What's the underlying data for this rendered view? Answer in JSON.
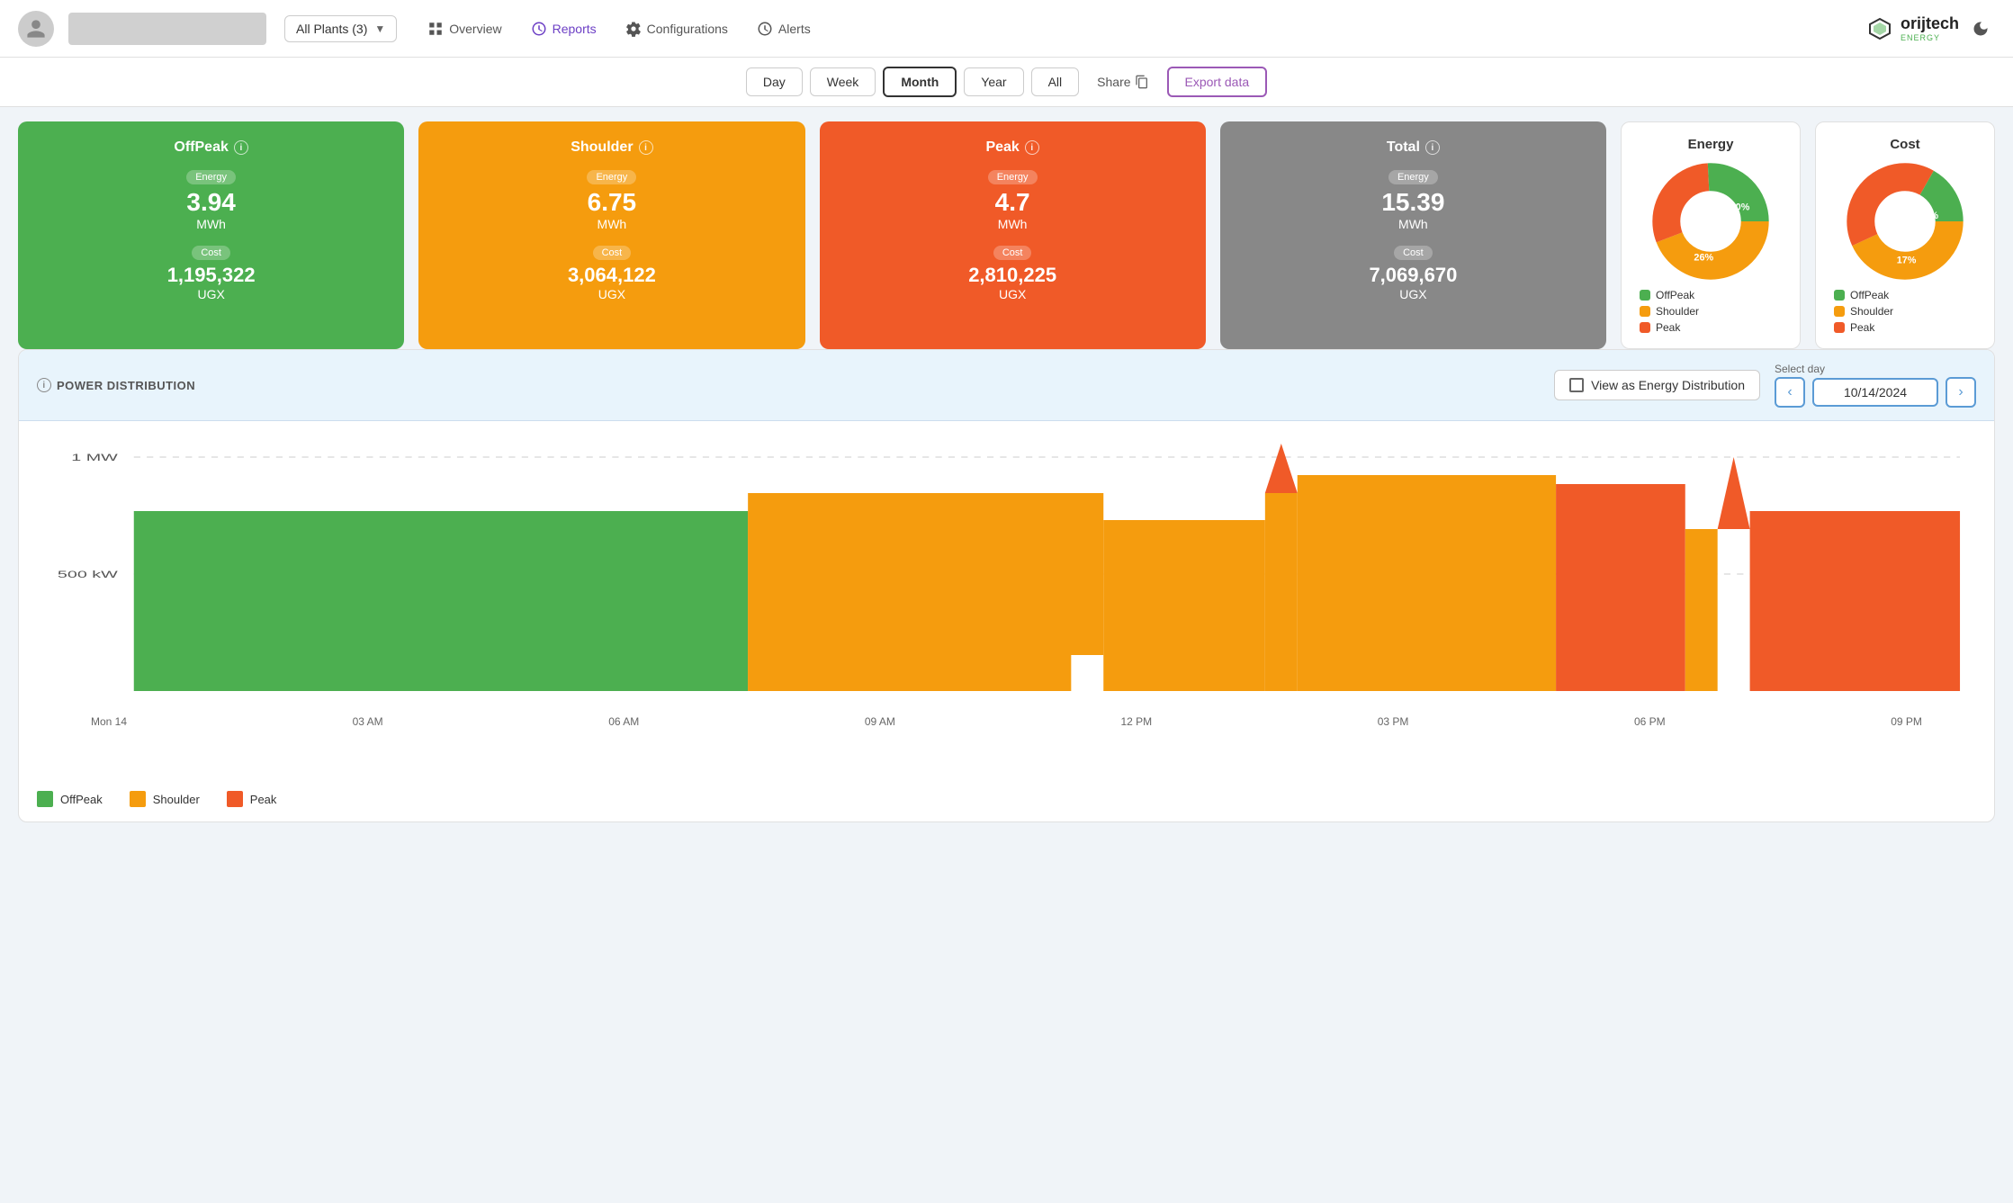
{
  "header": {
    "plant_selector": "All Plants (3)",
    "nav_items": [
      {
        "id": "overview",
        "label": "Overview",
        "icon": "grid"
      },
      {
        "id": "reports",
        "label": "Reports",
        "icon": "gear",
        "active": true
      },
      {
        "id": "configurations",
        "label": "Configurations",
        "icon": "gear"
      },
      {
        "id": "alerts",
        "label": "Alerts",
        "icon": "gear"
      }
    ],
    "brand_name": "orijtech",
    "brand_sub": "ENERGY"
  },
  "toolbar": {
    "periods": [
      "Day",
      "Week",
      "Month",
      "Year",
      "All"
    ],
    "active_period": "Month",
    "share_label": "Share",
    "export_label": "Export data"
  },
  "cards": {
    "offpeak": {
      "title": "OffPeak",
      "energy_label": "Energy",
      "energy_value": "3.94",
      "energy_unit": "MWh",
      "cost_label": "Cost",
      "cost_value": "1,195,322",
      "cost_unit": "UGX"
    },
    "shoulder": {
      "title": "Shoulder",
      "energy_label": "Energy",
      "energy_value": "6.75",
      "energy_unit": "MWh",
      "cost_label": "Cost",
      "cost_value": "3,064,122",
      "cost_unit": "UGX"
    },
    "peak": {
      "title": "Peak",
      "energy_label": "Energy",
      "energy_value": "4.7",
      "energy_unit": "MWh",
      "cost_label": "Cost",
      "cost_value": "2,810,225",
      "cost_unit": "UGX"
    },
    "total": {
      "title": "Total",
      "energy_label": "Energy",
      "energy_value": "15.39",
      "energy_unit": "MWh",
      "cost_label": "Cost",
      "cost_value": "7,069,670",
      "cost_unit": "UGX"
    }
  },
  "energy_chart": {
    "title": "Energy",
    "segments": [
      {
        "label": "OffPeak",
        "color": "#4caf50",
        "pct": 26
      },
      {
        "label": "Shoulder",
        "color": "#f59c0e",
        "pct": 44
      },
      {
        "label": "Peak",
        "color": "#f05a28",
        "pct": 30
      }
    ]
  },
  "cost_chart": {
    "title": "Cost",
    "segments": [
      {
        "label": "OffPeak",
        "color": "#4caf50",
        "pct": 17
      },
      {
        "label": "Shoulder",
        "color": "#f59c0e",
        "pct": 43
      },
      {
        "label": "Peak",
        "color": "#f05a28",
        "pct": 40
      }
    ]
  },
  "power_distribution": {
    "section_title": "POWER DISTRIBUTION",
    "view_toggle_label": "View as Energy Distribution",
    "date_label": "Select day",
    "date_value": "10/14/2024",
    "y_label_1": "1 MW",
    "y_label_2": "500 kW",
    "x_labels": [
      "Mon 14",
      "03 AM",
      "06 AM",
      "09 AM",
      "12 PM",
      "03 PM",
      "06 PM",
      "09 PM"
    ],
    "legend": [
      {
        "label": "OffPeak",
        "color": "#4caf50"
      },
      {
        "label": "Shoulder",
        "color": "#f59c0e"
      },
      {
        "label": "Peak",
        "color": "#f05a28"
      }
    ]
  }
}
